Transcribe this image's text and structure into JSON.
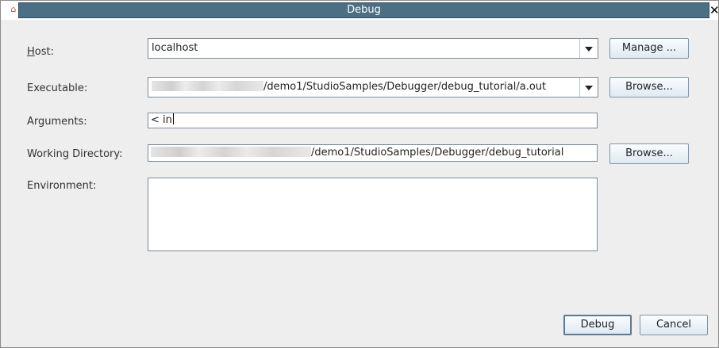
{
  "window": {
    "title": "Debug"
  },
  "form": {
    "host": {
      "label": "Host:",
      "value": "localhost"
    },
    "executable": {
      "label": "Executable:",
      "value": "/demo1/StudioSamples/Debugger/debug_tutorial/a.out"
    },
    "arguments": {
      "label": "Arguments:",
      "value": "< in"
    },
    "working_directory": {
      "label": "Working Directory:",
      "value": "/demo1/StudioSamples/Debugger/debug_tutorial"
    },
    "environment": {
      "label": "Environment:",
      "value": ""
    }
  },
  "buttons": {
    "manage": "Manage ...",
    "browse_executable": "Browse...",
    "browse_directory": "Browse...",
    "debug": "Debug",
    "cancel": "Cancel"
  },
  "colors": {
    "title_bar": "#4c6f84",
    "accent_border": "#5a7a95"
  },
  "icons": {
    "window_icon": "app-icon",
    "close": "close-icon",
    "dropdown": "chevron-down-icon"
  }
}
